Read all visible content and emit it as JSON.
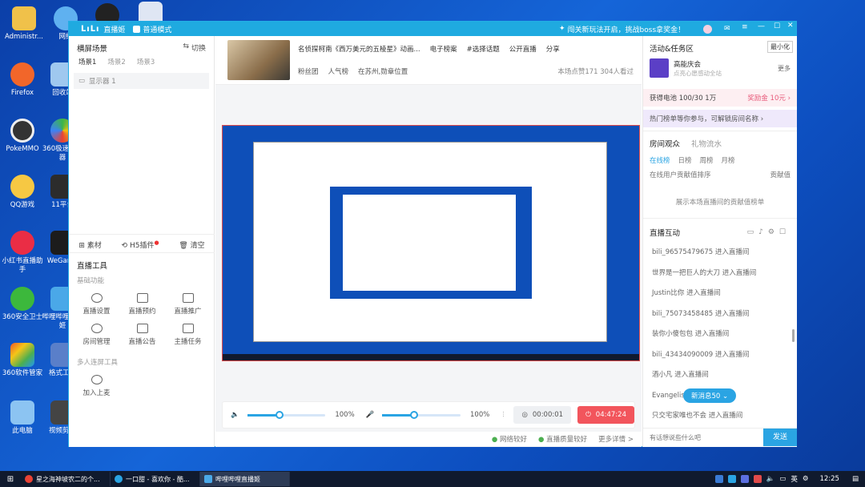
{
  "desktop": {
    "icons": [
      {
        "label": "Administr..."
      },
      {
        "label": "网络"
      },
      {
        "label": "Firefox"
      },
      {
        "label": "回收站"
      },
      {
        "label": "PokeMMO"
      },
      {
        "label": "360极速浏览器"
      },
      {
        "label": "QQ游戏"
      },
      {
        "label": "11平台"
      },
      {
        "label": "小红书直播助手"
      },
      {
        "label": "WeGame"
      },
      {
        "label": "360安全卫士"
      },
      {
        "label": "哔哩哔哩直播姬"
      },
      {
        "label": "360软件管家"
      },
      {
        "label": "格式工厂"
      },
      {
        "label": "此电脑"
      },
      {
        "label": "视频剪辑"
      }
    ]
  },
  "window": {
    "app_name": "直播姬",
    "mode_label": "普通模式",
    "promo": "闯关新玩法开启，挑战boss拿奖金！",
    "tooltip_minimize": "最小化"
  },
  "left": {
    "scene_title": "横屏场景",
    "switch_label": "切换",
    "scene_tabs": [
      "场景1",
      "场景2",
      "场景3"
    ],
    "source_item": "显示器 1",
    "tools": {
      "material": "素材",
      "h5": "H5插件",
      "clear": "清空"
    },
    "live_tools_title": "直播工具",
    "basic_title": "基础功能",
    "basic": [
      "直播设置",
      "直播预约",
      "直播推广",
      "房间管理",
      "直播公告",
      "主播任务"
    ],
    "multi_title": "多人连屏工具",
    "multi": [
      "加入上麦"
    ]
  },
  "center": {
    "stream_title": "名侦探柯南《西万美元的五棱星》动画...",
    "links": [
      "电子榜案",
      "#选择话题",
      "公开直播"
    ],
    "share": "分享",
    "tags": [
      "粉丝团",
      "人气榜",
      "在苏州,勋章位置"
    ],
    "stats": "本场点赞171  304人看过",
    "volume_speaker": "100%",
    "volume_mic": "100%",
    "speaker_level": 0.41,
    "mic_level": 0.41,
    "timer": "00:00:01",
    "live_time": "04:47:24",
    "status": [
      "网络较好",
      "直播质量较好",
      "更多详情 >"
    ]
  },
  "right": {
    "activity_title": "活动&任务区",
    "event_name": "高能庆会",
    "event_desc": "点亮心愿感动全站",
    "more": "更多",
    "battery": "获得电池  100/30 1万",
    "reward": "奖励金 10元",
    "promo_text": "热门榜单等你参与，可解锁房间名称",
    "tabs1": [
      "房间观众",
      "礼物流水"
    ],
    "subtabs": [
      "在线榜",
      "日榜",
      "周榜",
      "月榜"
    ],
    "rank_desc": "在线用户贡献值排序",
    "contrib": "贡献值",
    "empty_rank": "展示本场直播间的贡献值榜单",
    "interact_title": "直播互动",
    "chat": [
      "bili_96575479675 进入直播间",
      "世界是一把巨人的大刀 进入直播间",
      "Justin比你 进入直播间",
      "bili_75073458485 进入直播间",
      "装你小傻包包 进入直播间",
      "bili_43434090009 进入直播间",
      "酒小凡 进入直播间",
      "Evangeliser 进入直播间",
      "只交宅家唯也不会 进入直播间"
    ],
    "new_msg": "新消息50",
    "input_placeholder": "有话想说些什么吧",
    "send": "发送"
  },
  "taskbar": {
    "items": [
      "星之海神坡农二的个...",
      "一口甜 - 喜欢你 - 酷...",
      "哔哩哔哩直播姬"
    ],
    "ime": "英",
    "time": "12:25"
  }
}
